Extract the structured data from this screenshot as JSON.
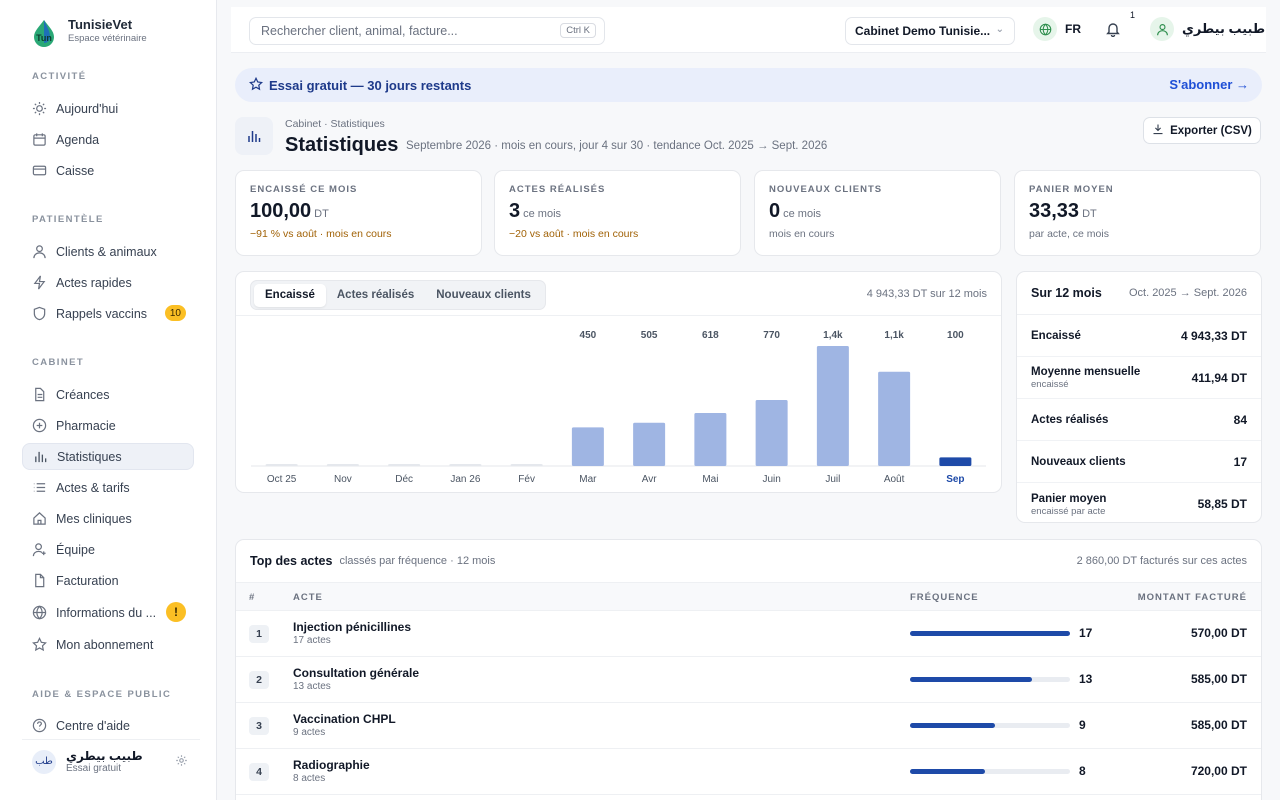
{
  "brand": {
    "name": "TunisieVet",
    "sub": "Espace vétérinaire",
    "logo_text": "Tun"
  },
  "sidebar": {
    "sections": [
      {
        "label": "ACTIVITÉ"
      },
      {
        "label": "PATIENTÈLE"
      },
      {
        "label": "CABINET"
      },
      {
        "label": "AIDE & ESPACE PUBLIC"
      }
    ],
    "items": [
      {
        "label": "Aujourd'hui",
        "icon": "sun-icon"
      },
      {
        "label": "Agenda",
        "icon": "calendar-icon"
      },
      {
        "label": "Caisse",
        "icon": "cash-icon"
      },
      {
        "label": "Clients & animaux",
        "icon": "user-icon"
      },
      {
        "label": "Actes rapides",
        "icon": "bolt-icon"
      },
      {
        "label": "Rappels vaccins",
        "icon": "shield-icon",
        "badge": "10"
      },
      {
        "label": "Créances",
        "icon": "document-icon"
      },
      {
        "label": "Pharmacie",
        "icon": "plus-circle-icon"
      },
      {
        "label": "Statistiques",
        "icon": "bar-chart-icon",
        "active": true
      },
      {
        "label": "Actes & tarifs",
        "icon": "list-icon"
      },
      {
        "label": "Mes cliniques",
        "icon": "home-icon"
      },
      {
        "label": "Équipe",
        "icon": "user-plus-icon"
      },
      {
        "label": "Facturation",
        "icon": "file-icon"
      },
      {
        "label": "Informations du ...",
        "icon": "globe-icon",
        "warn": "!"
      },
      {
        "label": "Mon abonnement",
        "icon": "star-icon"
      },
      {
        "label": "Centre d'aide",
        "icon": "help-icon"
      }
    ],
    "user": {
      "initials": "طب",
      "name": "طبيب بيطري",
      "plan": "Essai gratuit"
    }
  },
  "topbar": {
    "search_placeholder": "Rechercher client, animal, facture...",
    "shortcut": "Ctrl K",
    "clinic": "Cabinet Demo Tunisie...",
    "lang": "FR",
    "notif_count": "1",
    "user_name": "طبيب بيطري"
  },
  "trial": {
    "text": "Essai gratuit — 30 jours restants",
    "cta": "S'abonner →"
  },
  "page": {
    "breadcrumb": "Cabinet · Statistiques",
    "title": "Statistiques",
    "subtitle": "Septembre 2026 · mois en cours, jour 4 sur 30 · tendance Oct. 2025 → Sept. 2026",
    "export_label": "Exporter (CSV)"
  },
  "kpis": [
    {
      "label": "ENCAISSÉ CE MOIS",
      "value": "100,00",
      "unit": "DT",
      "note": "−91 % vs août · mois en cours",
      "warn": true
    },
    {
      "label": "ACTES RÉALISÉS",
      "value": "3",
      "unit": "ce mois",
      "note": "−20 vs août · mois en cours",
      "warn": true
    },
    {
      "label": "NOUVEAUX CLIENTS",
      "value": "0",
      "unit": "ce mois",
      "note": "mois en cours",
      "warn": false
    },
    {
      "label": "PANIER MOYEN",
      "value": "33,33",
      "unit": "DT",
      "note": "par acte, ce mois",
      "warn": false
    }
  ],
  "chart": {
    "tabs": [
      "Encaissé",
      "Actes réalisés",
      "Nouveaux clients"
    ],
    "active_tab": "Encaissé",
    "total": "4 943,33 DT sur 12 mois"
  },
  "chart_data": {
    "type": "bar",
    "categories": [
      "Oct 25",
      "Nov",
      "Déc",
      "Jan 26",
      "Fév",
      "Mar",
      "Avr",
      "Mai",
      "Juin",
      "Juil",
      "Août",
      "Sep"
    ],
    "values": [
      0,
      0,
      0,
      0,
      0,
      450,
      505,
      618,
      770,
      1400,
      1100,
      100
    ],
    "data_labels": [
      "",
      "",
      "",
      "",
      "",
      "450",
      "505",
      "618",
      "770",
      "1,4k",
      "1,1k",
      "100"
    ],
    "highlight": "Sep",
    "colors": {
      "bar": "#9fb5e3",
      "current": "#1e4aa8",
      "empty": "#e5e8ed"
    },
    "ylim": [
      0,
      1400
    ]
  },
  "summary": {
    "title": "Sur 12 mois",
    "range": "Oct. 2025 → Sept. 2026",
    "rows": [
      {
        "label": "Encaissé",
        "sub": "",
        "value": "4 943,33 DT"
      },
      {
        "label": "Moyenne mensuelle",
        "sub": "encaissé",
        "value": "411,94 DT"
      },
      {
        "label": "Actes réalisés",
        "sub": "",
        "value": "84"
      },
      {
        "label": "Nouveaux clients",
        "sub": "",
        "value": "17"
      },
      {
        "label": "Panier moyen",
        "sub": "encaissé par acte",
        "value": "58,85 DT"
      }
    ]
  },
  "acts": {
    "title": "Top des actes",
    "subtitle": "classés par fréquence · 12 mois",
    "total": "2 860,00 DT facturés sur ces actes",
    "columns": {
      "rank": "#",
      "act": "ACTE",
      "freq": "FRÉQUENCE",
      "amount": "MONTANT FACTURÉ"
    },
    "rows": [
      {
        "rank": "1",
        "name": "Injection pénicillines",
        "count": "17 actes",
        "freq": 17,
        "freq_label": "17",
        "amount": "570,00 DT"
      },
      {
        "rank": "2",
        "name": "Consultation générale",
        "count": "13 actes",
        "freq": 13,
        "freq_label": "13",
        "amount": "585,00 DT"
      },
      {
        "rank": "3",
        "name": "Vaccination CHPL",
        "count": "9 actes",
        "freq": 9,
        "freq_label": "9",
        "amount": "585,00 DT"
      },
      {
        "rank": "4",
        "name": "Radiographie",
        "count": "8 actes",
        "freq": 8,
        "freq_label": "8",
        "amount": "720,00 DT"
      }
    ],
    "max_freq": 17
  }
}
